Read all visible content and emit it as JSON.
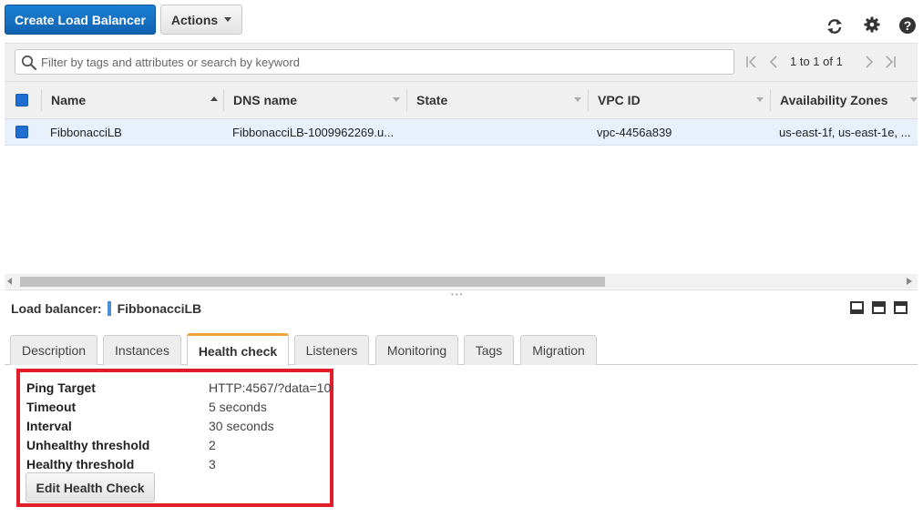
{
  "toolbar": {
    "create_label": "Create Load Balancer",
    "actions_label": "Actions",
    "icons": [
      "refresh-icon",
      "gear-icon",
      "help-icon"
    ]
  },
  "filter": {
    "placeholder": "Filter by tags and attributes or search by keyword",
    "pagination": "1 to 1 of 1"
  },
  "table": {
    "columns": [
      "Name",
      "DNS name",
      "State",
      "VPC ID",
      "Availability Zones"
    ],
    "rows": [
      {
        "name": "FibbonacciLB",
        "dns": "FibbonacciLB-1009962269.u...",
        "state": "",
        "vpc": "vpc-4456a839",
        "azs": "us-east-1f, us-east-1e, ..."
      }
    ]
  },
  "details": {
    "label": "Load balancer:",
    "name": "FibbonacciLB",
    "tabs": [
      "Description",
      "Instances",
      "Health check",
      "Listeners",
      "Monitoring",
      "Tags",
      "Migration"
    ],
    "active_tab": "Health check"
  },
  "health_check": {
    "rows": [
      {
        "label": "Ping Target",
        "value": "HTTP:4567/?data=10"
      },
      {
        "label": "Timeout",
        "value": "5 seconds"
      },
      {
        "label": "Interval",
        "value": "30 seconds"
      },
      {
        "label": "Unhealthy threshold",
        "value": "2"
      },
      {
        "label": "Healthy threshold",
        "value": "3"
      }
    ],
    "edit_label": "Edit Health Check"
  },
  "colors": {
    "primary_button": "#1162b0",
    "highlight_box": "#e11d2a",
    "active_tab_accent": "#f0a23b",
    "selected_row": "#e8f1fb"
  }
}
